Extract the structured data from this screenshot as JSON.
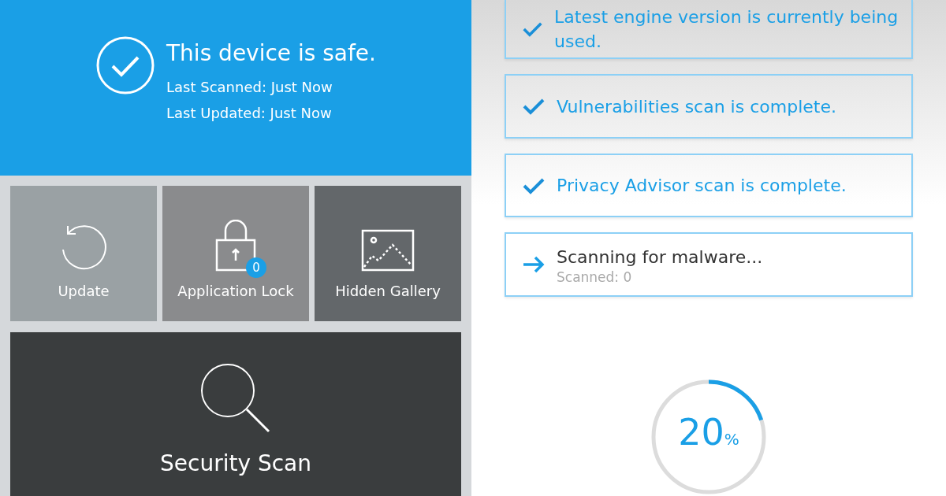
{
  "status": {
    "title": "This device is safe.",
    "lines": [
      "Last Scanned: Just Now",
      "Last Updated: Just Now"
    ]
  },
  "tiles": [
    {
      "kind": "update",
      "label": "Update"
    },
    {
      "kind": "lock",
      "label": "Application Lock",
      "badge": "0"
    },
    {
      "kind": "gallery",
      "label": "Hidden Gallery"
    }
  ],
  "scan_button": {
    "label": "Security Scan"
  },
  "checks": [
    {
      "kind": "done",
      "text": "Latest engine version is currently being used."
    },
    {
      "kind": "done",
      "text": "Vulnerabilities scan is complete."
    },
    {
      "kind": "done",
      "text": "Privacy Advisor scan is complete."
    },
    {
      "kind": "active",
      "text": "Scanning for malware...",
      "subtext": "Scanned: 0"
    }
  ],
  "progress": {
    "level": 0.2,
    "value": "20",
    "unit": "%"
  }
}
